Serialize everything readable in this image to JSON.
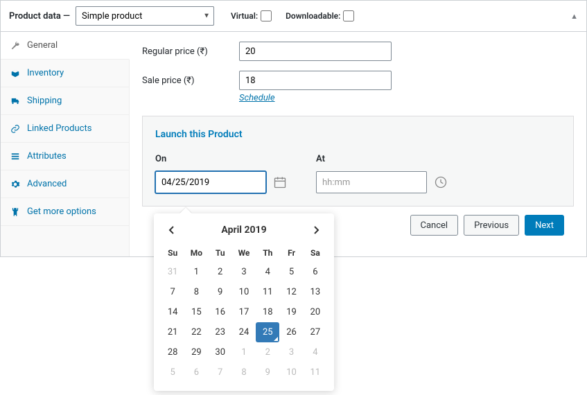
{
  "header": {
    "title": "Product data —",
    "product_type": "Simple product",
    "virtual_label": "Virtual:",
    "downloadable_label": "Downloadable:"
  },
  "sidebar": {
    "items": [
      {
        "icon": "wrench",
        "label": "General"
      },
      {
        "icon": "box",
        "label": "Inventory"
      },
      {
        "icon": "truck",
        "label": "Shipping"
      },
      {
        "icon": "link",
        "label": "Linked Products"
      },
      {
        "icon": "list",
        "label": "Attributes"
      },
      {
        "icon": "gear",
        "label": "Advanced"
      },
      {
        "icon": "plugin",
        "label": "Get more options"
      }
    ]
  },
  "fields": {
    "regular_price_label": "Regular price (₹)",
    "regular_price": "20",
    "sale_price_label": "Sale price (₹)",
    "sale_price": "18",
    "schedule": "Schedule"
  },
  "launch": {
    "heading": "Launch this Product",
    "on_label": "On",
    "at_label": "At",
    "date_value": "04/25/2019",
    "time_placeholder": "hh:mm"
  },
  "footer": {
    "cancel": "Cancel",
    "previous": "Previous",
    "next": "Next"
  },
  "datepicker": {
    "month": "April 2019",
    "dow": [
      "Su",
      "Mo",
      "Tu",
      "We",
      "Th",
      "Fr",
      "Sa"
    ],
    "weeks": [
      [
        {
          "d": 31,
          "m": true
        },
        {
          "d": 1
        },
        {
          "d": 2
        },
        {
          "d": 3
        },
        {
          "d": 4
        },
        {
          "d": 5
        },
        {
          "d": 6
        }
      ],
      [
        {
          "d": 7
        },
        {
          "d": 8
        },
        {
          "d": 9
        },
        {
          "d": 10
        },
        {
          "d": 11
        },
        {
          "d": 12
        },
        {
          "d": 13
        }
      ],
      [
        {
          "d": 14
        },
        {
          "d": 15
        },
        {
          "d": 16
        },
        {
          "d": 17
        },
        {
          "d": 18
        },
        {
          "d": 19
        },
        {
          "d": 20
        }
      ],
      [
        {
          "d": 21
        },
        {
          "d": 22
        },
        {
          "d": 23
        },
        {
          "d": 24
        },
        {
          "d": 25,
          "sel": true
        },
        {
          "d": 26
        },
        {
          "d": 27
        }
      ],
      [
        {
          "d": 28
        },
        {
          "d": 29
        },
        {
          "d": 30
        },
        {
          "d": 1,
          "m": true
        },
        {
          "d": 2,
          "m": true
        },
        {
          "d": 3,
          "m": true
        },
        {
          "d": 4,
          "m": true
        }
      ],
      [
        {
          "d": 5,
          "m": true
        },
        {
          "d": 6,
          "m": true
        },
        {
          "d": 7,
          "m": true
        },
        {
          "d": 8,
          "m": true
        },
        {
          "d": 9,
          "m": true
        },
        {
          "d": 10,
          "m": true
        },
        {
          "d": 11,
          "m": true
        }
      ]
    ]
  }
}
